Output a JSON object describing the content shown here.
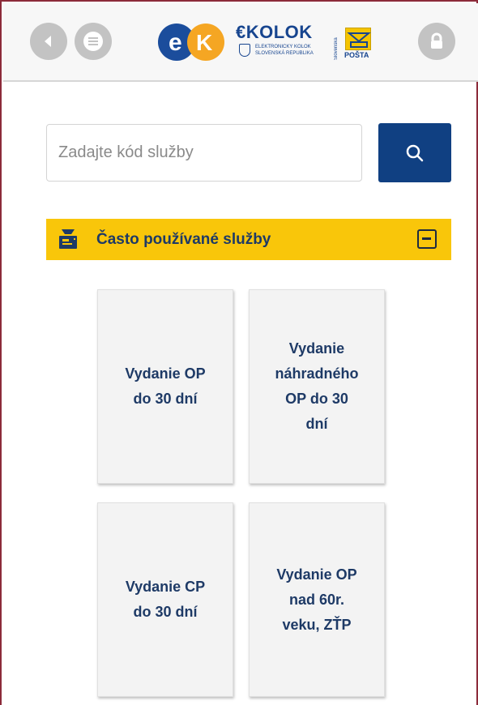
{
  "header": {
    "back_icon": "chevron-left-icon",
    "menu_icon": "menu-list-icon",
    "lock_icon": "lock-icon",
    "logo_ek": "eK",
    "logo_ekolok": {
      "title": "€KOLOK",
      "subtitle_line1": "ELEKTRONICKÝ KOLOK",
      "subtitle_line2": "SLOVENSKÁ REPUBLIKA"
    },
    "logo_posta": {
      "vertical_text": "Slovenská",
      "label": "POŠTA"
    }
  },
  "search": {
    "placeholder": "Zadajte kód služby",
    "value": "",
    "button_icon": "search-icon"
  },
  "section": {
    "icon": "stamp-machine-icon",
    "title": "Často používané služby",
    "collapse_icon": "minus-square-icon"
  },
  "services": [
    {
      "label": "Vydanie OP\ndo 30 dní"
    },
    {
      "label": "Vydanie\nnáhradného\nOP do 30\ndní"
    },
    {
      "label": "Vydanie CP\ndo 30 dní"
    },
    {
      "label": "Vydanie OP\nnad 60r.\nveku, ZŤP"
    }
  ],
  "colors": {
    "brand_blue": "#104082",
    "section_yellow": "#f9c60a",
    "text_navy": "#1e3a66",
    "button_grey": "#c3c3c3",
    "frame": "#8c2b3a"
  }
}
